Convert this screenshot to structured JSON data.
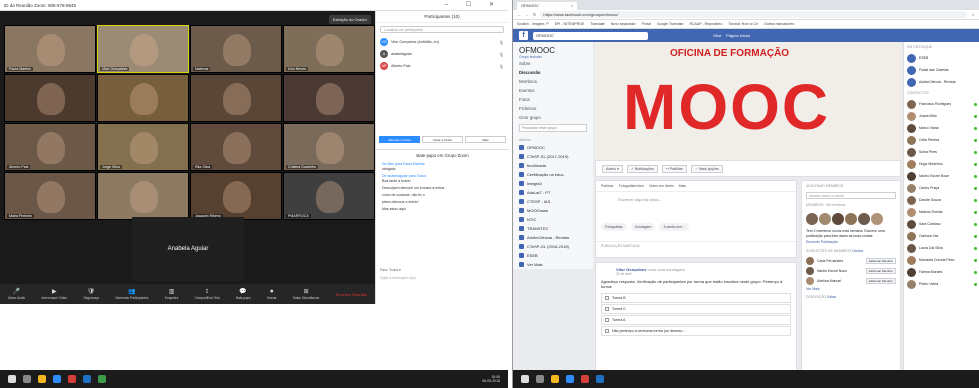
{
  "zoom": {
    "title": "ID da Reunião Zoom: 905-578-8945",
    "window_controls": "‒ ☐ ✕",
    "gallery_btn": "Exibição do Orador",
    "tiles": [
      {
        "name": "Paula Martins",
        "bg": "#8a7762"
      },
      {
        "name": "Vitor Gonçalves",
        "bg": "#9b8a74"
      },
      {
        "name": "Natércia",
        "bg": "#6c5b4a"
      },
      {
        "name": "Ivón Neves",
        "bg": "#7d6d59"
      },
      {
        "name": "",
        "bg": "#4d3a2f"
      },
      {
        "name": "",
        "bg": "#775e3c"
      },
      {
        "name": "",
        "bg": "#5a4636"
      },
      {
        "name": "",
        "bg": "#4a3a33"
      },
      {
        "name": "Alberto Pais",
        "bg": "#6b5847"
      },
      {
        "name": "Jorge Silva",
        "bg": "#82704f"
      },
      {
        "name": "Rita Silva",
        "bg": "#5f4a3c"
      },
      {
        "name": "Cristina Guarinho",
        "bg": "#7a6a5a"
      },
      {
        "name": "Maria Pinheiro",
        "bg": "#6a5748"
      },
      {
        "name": "",
        "bg": "#8c7a63"
      },
      {
        "name": "Joaquim Ribeiro",
        "bg": "#564131"
      },
      {
        "name": "PMARROCA",
        "bg": "#3f3f3f"
      }
    ],
    "big_name": "Anabela Aguiar",
    "toolbar": {
      "items": [
        {
          "icon": "🎤",
          "label": "Ativar Áudio"
        },
        {
          "icon": "▶",
          "label": "Interromper Vídeo"
        },
        {
          "icon": "🛡",
          "label": "Segurança"
        },
        {
          "icon": "👥",
          "label": "Gerenciar Participantes"
        },
        {
          "icon": "▥",
          "label": "Enquetes"
        },
        {
          "icon": "⇪",
          "label": "Compartilhar Tela"
        },
        {
          "icon": "💬",
          "label": "Bate-papo"
        },
        {
          "icon": "⏺",
          "label": "Gravar"
        },
        {
          "icon": "⊞",
          "label": "Salas Simultâneas"
        }
      ],
      "end": "Encerrar Reunião"
    },
    "participants": {
      "header": "Participantes (10)",
      "search": "Localizar um participante",
      "rows": [
        {
          "initials": "VG",
          "name": "Vitor Gonçalves (Anfitrião, eu)",
          "color": "#2d8cff"
        },
        {
          "initials": "A",
          "name": "anabelaguiar",
          "color": "#555"
        },
        {
          "initials": "AP",
          "name": "Alberto Pais",
          "color": "#d94a4a"
        }
      ],
      "buttons": [
        "Silenciar a Todos",
        "Ativar a Todos",
        "Mais"
      ]
    },
    "chat": {
      "header": "Bate-papo em Grupo Zoom",
      "messages": [
        {
          "from": "De Mim para Paula Martins:",
          "text": "obrigado"
        },
        {
          "from": "De anabelaguiar para Todos:",
          "text": "Boa tarde a todos!"
        },
        {
          "from": "",
          "text": "Desculpem demorei um bocado a entrar;"
        },
        {
          "from": "",
          "text": "como de costume, não fiz o"
        },
        {
          "from": "",
          "text": "plano demorar a entrar!"
        },
        {
          "from": "",
          "text": "Mas estou aqui"
        }
      ],
      "to": "Para: Todos ▾",
      "input": "Digite a mensagem aqui..."
    },
    "tray": [
      "18:05",
      "06-05-2018"
    ]
  },
  "fb": {
    "tab": "OFMOOC",
    "url": "https://www.facebook.com/groups/ofmooc/",
    "bookmarks": [
      "Scratch - Imagine, P",
      "EPI - NITEMPROE",
      "Translate",
      "Novo separador",
      "Portal",
      "Google Translate",
      "RCAAP - Repositório",
      "Tutorial: How to Cri",
      "Outros marcadores"
    ],
    "search": "OFMOOC",
    "user": "Vitor",
    "home": "Página inicial",
    "group_name": "OFMOOC",
    "group_type": "Grupo fechado",
    "nav": [
      "Sobre",
      "Discussão",
      "Membros",
      "Eventos",
      "Fotos",
      "Ficheiros",
      "Gerir grupo"
    ],
    "search_group": "Pesquisar neste grupo",
    "shortcuts_label": "Atalhos",
    "shortcuts": [
      "OFMOOC",
      "CTeSP-SL (2017-2019)",
      "tecAlmada",
      "Certificação na educ.",
      "Integra3",
      "AdsLat7 - PT",
      "CTESP - IAS",
      "MOOCbase",
      "NTIC",
      "TRANSTEC",
      "AdobeCiência - Revista",
      "CTeSP-GL (2016-2018)",
      "ESEB",
      "Ver Mais"
    ],
    "cover_title": "OFICINA DE FORMAÇÃO",
    "cover_big": "MOOC",
    "gbar": [
      "Aderiu ▾",
      "✓ Notificações",
      "↪ Partilhar",
      "··· Mais opções"
    ],
    "composer": {
      "tabs": [
        "Publicar",
        "Fotografia/vídeo",
        "Vídeo em direto",
        "Mais"
      ],
      "placeholder": "Escrever alguma coisa...",
      "buttons": [
        "Fotografias",
        "Sondagem",
        "A sentir-me/..."
      ],
      "pinned": "PUBLICAÇÃO MARCADA"
    },
    "post": {
      "author": "Vitor Gonçalves",
      "shared": "criou uma sondagem",
      "date": "20 de abril",
      "text": "Agradeço resposta. Verificação de participantes por turma que estão inscritos neste grupo. Pertenço à turma:",
      "options": [
        "Turma B",
        "Turma C",
        "Turma A",
        "Não pertenço a nenhuma turma (ou demoro..."
      ]
    },
    "right": {
      "add_title": "ADICIONAR MEMBROS",
      "add_placeholder": "Introduz nome ou email",
      "members": "MEMBROS",
      "members_count": "65 membros",
      "new_text": "Tem 2 membros novos esta semana. Escreve uma publicação para lhes dares as boas-vindas.",
      "write": "Escrever Publicação",
      "suggest": "SUGESTÕES DE MEMBROS",
      "suggest_act": "Ocultar",
      "people": [
        {
          "name": "Carla Fernandes",
          "btn": "Adicionar Membro"
        },
        {
          "name": "Nacho Escrei Nous",
          "btn": "Adicionar Membro"
        },
        {
          "name": "Adelina Manuel",
          "btn": "Adicionar Membro"
        }
      ],
      "see_more": "Ver Mais",
      "desc": "DESCRIÇÃO",
      "edit": "Editar"
    },
    "contacts": {
      "header": "EM DESTAQUE",
      "pinned": [
        "ESEB",
        "Portal das Cadeias",
        "AdobeCiência - Revista"
      ],
      "chat_header": "CONTACTOS",
      "people": [
        "Francisco Rodrigues",
        "Joana Brito",
        "Marco Viana",
        "Célia Pereira",
        "Sónia Pires",
        "Hugo Medeiros",
        "Nacho Escrei Noue",
        "Carlos Praça",
        "Davide Souza",
        "Mateus Romão",
        "Sara Cardoso",
        "Clarissa Vaz",
        "Laura Dal Silva",
        "Michaela Correia Pinto",
        "Fatima Moraes",
        "Pedro Vieira"
      ],
      "foot": "Pesquisar"
    }
  }
}
